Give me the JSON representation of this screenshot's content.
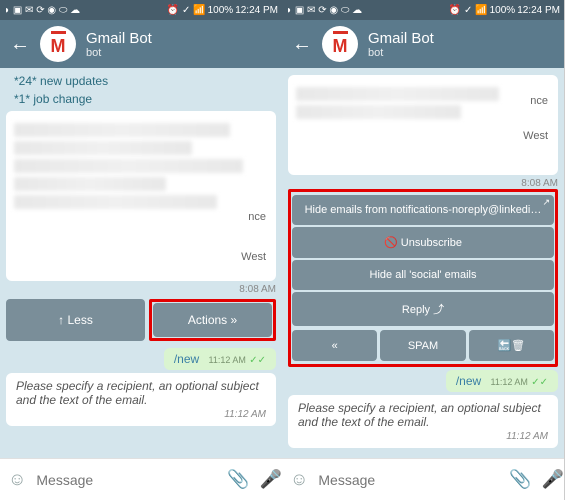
{
  "status": {
    "time": "12:24 PM",
    "battery": "100%",
    "icons_left": "◗ ▣ ✉ ⟳ ◉ ⬭ ☁",
    "icons_right": "⏰ ✓ 📶"
  },
  "header": {
    "title": "Gmail Bot",
    "subtitle": "bot"
  },
  "updates": {
    "line1": "*24* new updates",
    "line2": "*1* job change"
  },
  "blurred": {
    "t1": "nce",
    "t2": "West",
    "time": "8:08 AM"
  },
  "left": {
    "less": "↑ Less",
    "actions": "Actions »"
  },
  "right": {
    "hide": "Hide emails from notifications-noreply@linkedi…",
    "unsub": "🚫 Unsubscribe",
    "hideall": "Hide all 'social' emails",
    "reply": "Reply ⤴",
    "prev": "«",
    "spam": "SPAM",
    "back": "🔙🗑"
  },
  "cmd": {
    "text": "/new",
    "time": "11:12 AM"
  },
  "prompt": "Please specify a recipient, an optional subject and the text of the email.",
  "prompt_time": "11:12 AM",
  "input": {
    "placeholder": "Message"
  }
}
